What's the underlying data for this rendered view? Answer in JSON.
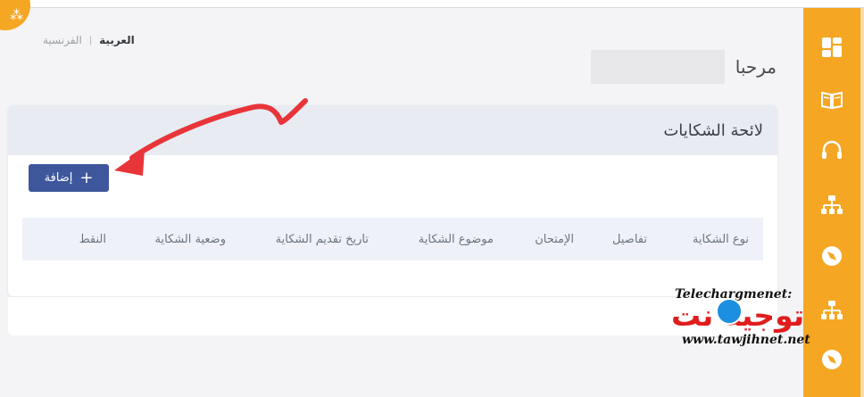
{
  "language": {
    "active": "العربية",
    "inactive": "الفرنسية"
  },
  "welcome": {
    "greeting": "مرحبا"
  },
  "complaints_card": {
    "title": "لائحة الشكايات",
    "add_button_label": "إضافة",
    "columns": [
      "نوع الشكاية",
      "تفاصيل",
      "الإمتحان",
      "موضوع الشكاية",
      "تاريخ تقديم الشكاية",
      "وضعية الشكاية",
      "النقط"
    ]
  },
  "sidebar": {
    "icons": [
      "dashboard-icon",
      "book-icon",
      "headset-icon",
      "network-icon",
      "compass-icon",
      "network-icon",
      "compass-icon"
    ]
  },
  "watermark": {
    "line1": "Telechargmenet:",
    "brand": "توجيه نت",
    "url": "www.tawjihnet.net"
  },
  "colors": {
    "accent": "#f5a623",
    "button": "#3d569c",
    "header_bg": "#e8ebf2",
    "arrow": "#e8353a"
  }
}
